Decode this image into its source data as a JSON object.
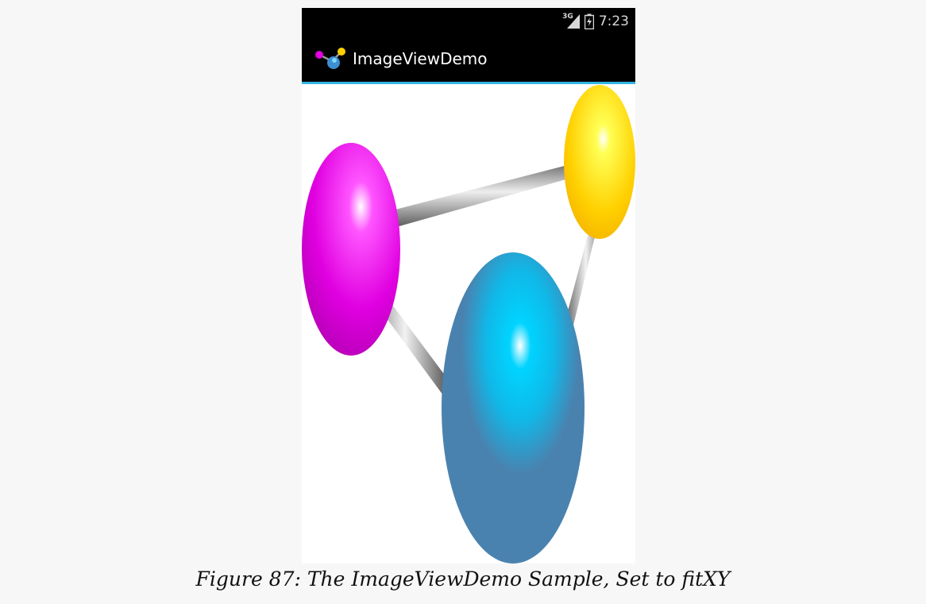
{
  "status_bar": {
    "network_type": "3G",
    "time": "7:23",
    "icons": [
      "signal-icon",
      "battery-icon"
    ]
  },
  "action_bar": {
    "title": "ImageViewDemo",
    "icon": "molecule-icon",
    "accent_color": "#33b5e5"
  },
  "image": {
    "icon": "molecule-image",
    "scale_type": "fitXY",
    "colors": {
      "magenta": "#e000e0",
      "yellow": "#ffd000",
      "blue": "#4a82af",
      "cyan": "#00c8f5"
    }
  },
  "caption": {
    "text": "Figure 87: The ImageViewDemo Sample, Set to fitXY"
  }
}
